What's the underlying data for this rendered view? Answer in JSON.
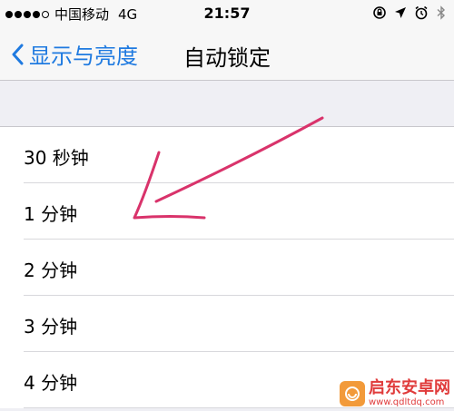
{
  "status_bar": {
    "carrier": "中国移动",
    "network": "4G",
    "time": "21:57",
    "signal_filled": 4,
    "signal_total": 5,
    "icons": [
      "orientation-lock-icon",
      "location-icon",
      "alarm-icon",
      "bluetooth-icon"
    ]
  },
  "nav": {
    "back_label": "显示与亮度",
    "title": "自动锁定"
  },
  "options": [
    {
      "label": "30 秒钟"
    },
    {
      "label": "1 分钟"
    },
    {
      "label": "2 分钟"
    },
    {
      "label": "3 分钟"
    },
    {
      "label": "4 分钟"
    }
  ],
  "annotation": {
    "arrow_color": "#d9336b",
    "points_to": "1 分钟"
  },
  "watermark": {
    "name": "启东安卓网",
    "url": "www.qdltdq.com"
  },
  "colors": {
    "accent": "#1f7ae0",
    "background": "#efeff4"
  }
}
